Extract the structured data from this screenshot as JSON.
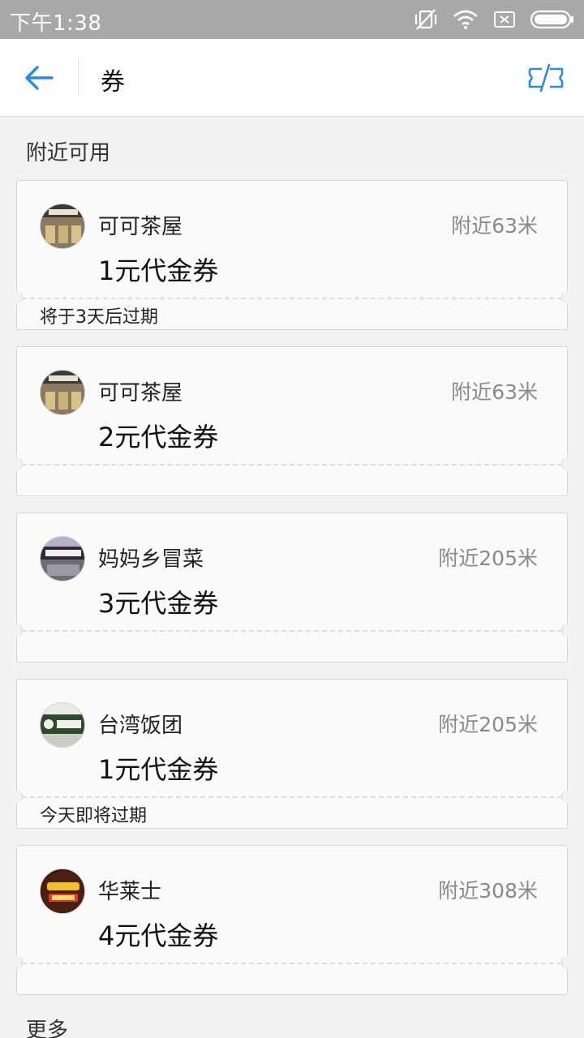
{
  "status_bar": {
    "time": "下午1:38"
  },
  "header": {
    "title": "券"
  },
  "section_title": "附近可用",
  "coupons": [
    {
      "shop": "可可茶屋",
      "distance": "附近63米",
      "amount": "1元代金券",
      "expire": "将于3天后过期"
    },
    {
      "shop": "可可茶屋",
      "distance": "附近63米",
      "amount": "2元代金券",
      "expire": ""
    },
    {
      "shop": "妈妈乡冒菜",
      "distance": "附近205米",
      "amount": "3元代金券",
      "expire": ""
    },
    {
      "shop": "台湾饭团",
      "distance": "附近205米",
      "amount": "1元代金券",
      "expire": "今天即将过期"
    },
    {
      "shop": "华莱士",
      "distance": "附近308米",
      "amount": "4元代金券",
      "expire": ""
    }
  ],
  "more_label": "更多",
  "colors": {
    "accent": "#2a8be0",
    "status_bar": "#a8a8a8",
    "subtle_text": "#8a8a8a"
  },
  "icons": {
    "back": "arrow-left-icon",
    "edit": "edit-ticket-icon",
    "mute": "vibrate-off-icon",
    "wifi": "wifi-icon",
    "sim": "no-sim-icon",
    "battery": "battery-icon"
  }
}
